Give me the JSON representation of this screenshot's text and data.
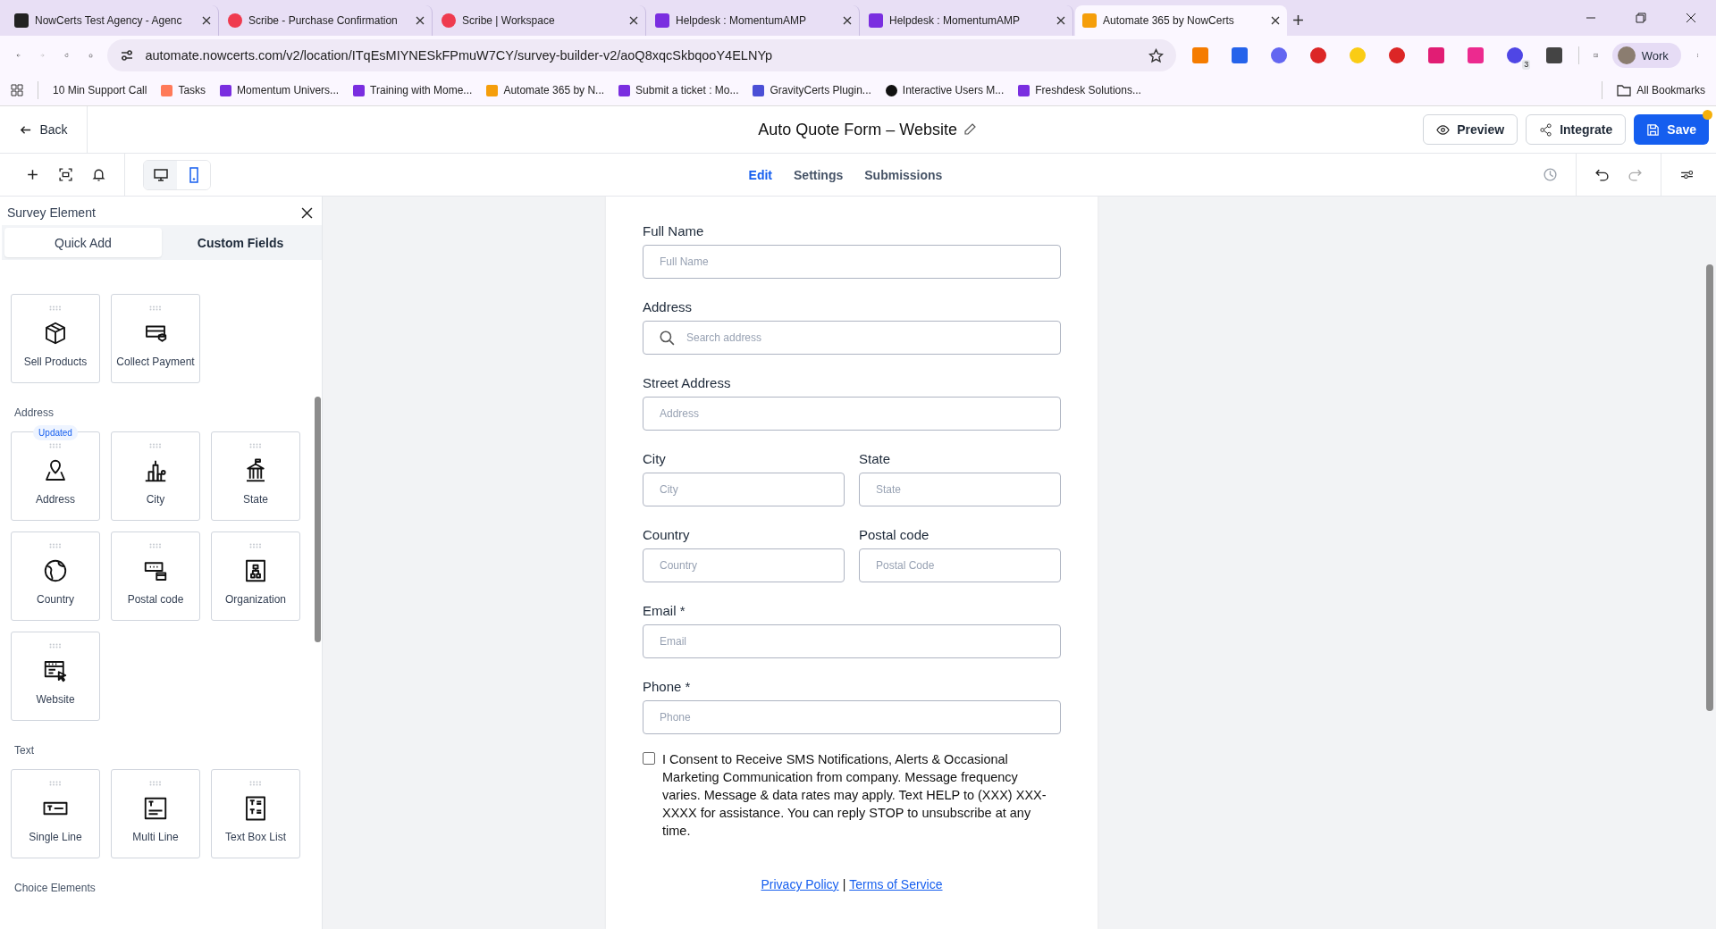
{
  "browser": {
    "tabs": [
      {
        "title": "NowCerts Test Agency - Agenc",
        "kind": "nowcerts",
        "selected": false
      },
      {
        "title": "Scribe - Purchase Confirmation",
        "kind": "scribe",
        "selected": false
      },
      {
        "title": "Scribe | Workspace",
        "kind": "scribe",
        "selected": false
      },
      {
        "title": "Helpdesk : MomentumAMP",
        "kind": "momentum",
        "selected": false
      },
      {
        "title": "Helpdesk : MomentumAMP",
        "kind": "momentum",
        "selected": false
      },
      {
        "title": "Automate 365 by NowCerts",
        "kind": "automate",
        "selected": true
      }
    ],
    "url": "automate.nowcerts.com/v2/location/ITqEsMIYNESkFPmuW7CY/survey-builder-v2/aoQ8xqcSkbqooY4ELNYp",
    "extensions": [
      {
        "kind": "hubspot"
      },
      {
        "kind": "stack"
      },
      {
        "kind": "gear"
      },
      {
        "kind": "drop"
      },
      {
        "kind": "ring"
      },
      {
        "kind": "grammar"
      },
      {
        "kind": "flag"
      },
      {
        "kind": "bolt"
      },
      {
        "kind": "sync",
        "badge": "3"
      },
      {
        "kind": "puzzle"
      }
    ],
    "profile": "Work",
    "bookmarks": [
      {
        "label": "10 Min Support Call"
      },
      {
        "label": "Tasks",
        "kind": "hubspot"
      },
      {
        "label": "Momentum Univers...",
        "kind": "momentum"
      },
      {
        "label": "Training with Mome...",
        "kind": "momentum"
      },
      {
        "label": "Automate 365 by N...",
        "kind": "automate"
      },
      {
        "label": "Submit a ticket : Mo...",
        "kind": "momentum"
      },
      {
        "label": "GravityCerts Plugin...",
        "kind": "gravity"
      },
      {
        "label": "Interactive Users M...",
        "kind": "interactive"
      },
      {
        "label": "Freshdesk Solutions...",
        "kind": "momentum"
      }
    ],
    "all_bookmarks": "All Bookmarks"
  },
  "header": {
    "back": "Back",
    "title": "Auto Quote Form – Website",
    "preview": "Preview",
    "integrate": "Integrate",
    "save": "Save",
    "unsaved": true
  },
  "toolbar": {
    "views": [
      {
        "kind": "desktop",
        "selected": false
      },
      {
        "kind": "mobile",
        "selected": true
      }
    ],
    "tabs": [
      {
        "label": "Edit",
        "selected": true
      },
      {
        "label": "Settings",
        "selected": false
      },
      {
        "label": "Submissions",
        "selected": false
      }
    ]
  },
  "panel": {
    "title": "Survey Element",
    "tabs": [
      {
        "label": "Quick Add",
        "selected": true
      },
      {
        "label": "Custom Fields",
        "selected": false
      }
    ],
    "sections": [
      {
        "items": [
          {
            "label": "Sell Products",
            "kind": "box"
          },
          {
            "label": "Collect Payment",
            "kind": "card"
          }
        ]
      },
      {
        "title": "Address",
        "items": [
          {
            "label": "Address",
            "kind": "pin",
            "badge": "Updated"
          },
          {
            "label": "City",
            "kind": "city"
          },
          {
            "label": "State",
            "kind": "state"
          },
          {
            "label": "Country",
            "kind": "globe"
          },
          {
            "label": "Postal code",
            "kind": "postal"
          },
          {
            "label": "Organization",
            "kind": "org"
          },
          {
            "label": "Website",
            "kind": "web"
          }
        ]
      },
      {
        "title": "Text",
        "items": [
          {
            "label": "Single Line",
            "kind": "single"
          },
          {
            "label": "Multi Line",
            "kind": "multi"
          },
          {
            "label": "Text Box List",
            "kind": "list"
          }
        ]
      },
      {
        "title": "Choice Elements"
      }
    ]
  },
  "form": {
    "rows": [
      [
        {
          "label": "Full Name",
          "placeholder": "Full Name",
          "kind": "text"
        }
      ],
      [
        {
          "label": "Address",
          "placeholder": "Search address",
          "kind": "search"
        }
      ],
      [
        {
          "label": "Street Address",
          "placeholder": "Address",
          "kind": "text"
        }
      ],
      [
        {
          "label": "City",
          "placeholder": "City",
          "kind": "text"
        },
        {
          "label": "State",
          "placeholder": "State",
          "kind": "text"
        }
      ],
      [
        {
          "label": "Country",
          "placeholder": "Country",
          "kind": "text"
        },
        {
          "label": "Postal code",
          "placeholder": "Postal Code",
          "kind": "text"
        }
      ],
      [
        {
          "label": "Email *",
          "placeholder": "Email",
          "kind": "text"
        }
      ],
      [
        {
          "label": "Phone *",
          "placeholder": "Phone",
          "kind": "text"
        }
      ]
    ],
    "consent": {
      "checked": false,
      "text": "I Consent to Receive SMS Notifications, Alerts & Occasional Marketing Communication from company. Message frequency varies. Message & data rates may apply. Text HELP to (XXX) XXX-XXXX for assistance. You can reply STOP to unsubscribe at any time."
    },
    "links": [
      {
        "label": "Privacy Policy"
      },
      {
        "label": "Terms of Service"
      }
    ],
    "separator": "|"
  }
}
